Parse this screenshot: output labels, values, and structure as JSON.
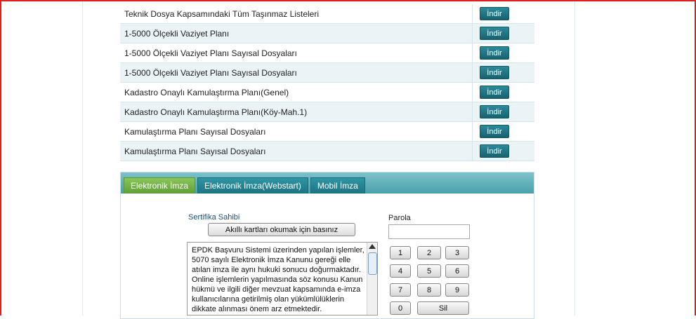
{
  "files": {
    "download_label": "İndir",
    "rows": [
      {
        "name": "Teknik Dosya Kapsamındaki Tüm Taşınmaz Listeleri"
      },
      {
        "name": "1-5000 Ölçekli Vaziyet Planı"
      },
      {
        "name": "1-5000 Ölçekli Vaziyet Planı Sayısal Dosyaları"
      },
      {
        "name": "1-5000 Ölçekli Vaziyet Planı Sayısal Dosyaları"
      },
      {
        "name": "Kadastro Onaylı Kamulaştırma Planı(Genel)"
      },
      {
        "name": "Kadastro Onaylı Kamulaştırma Planı(Köy-Mah.1)"
      },
      {
        "name": "Kamulaştırma Planı Sayısal Dosyaları"
      },
      {
        "name": "Kamulaştırma Planı Sayısal Dosyaları"
      }
    ]
  },
  "signature": {
    "tabs": [
      {
        "label": "Elektronik İmza",
        "active": true
      },
      {
        "label": "Elektronik İmza(Webstart)",
        "active": false
      },
      {
        "label": "Mobil İmza",
        "active": false
      }
    ],
    "certificate_owner_label": "Sertifika Sahibi",
    "read_cards_button": "Akıllı kartları okumak için basınız",
    "info_text": "EPDK Başvuru Sistemi üzerinden yapılan işlemler, 5070 sayılı Elektronik İmza Kanunu gereği elle atılan imza ile aynı hukuki sonucu doğurmaktadır. Online işlemlerin yapılmasında söz konusu Kanun hükmü ve ilgili diğer mevzuat kapsamında e-imza kullanıcılarına getirilmiş olan yükümlülüklerin dikkate alınması önem arz etmektedir.",
    "password_label": "Parola",
    "password_value": "",
    "keypad": [
      "1",
      "2",
      "3",
      "4",
      "5",
      "6",
      "7",
      "8",
      "9",
      "0"
    ],
    "delete_key": "Sil"
  }
}
